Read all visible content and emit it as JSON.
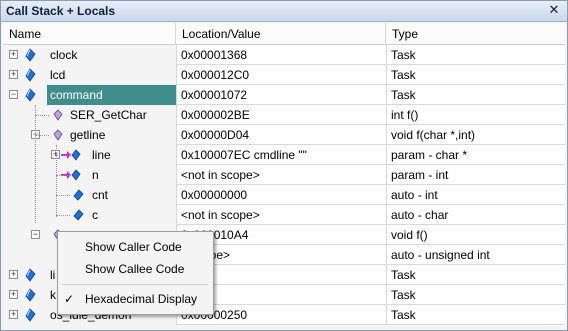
{
  "window": {
    "title": "Call Stack + Locals",
    "close_glyph": "✕"
  },
  "columns": [
    "Name",
    "Location/Value",
    "Type"
  ],
  "rows": [
    {
      "name": "clock",
      "value": "0x00001368",
      "type": "Task",
      "level": 0,
      "expander": "+",
      "icon": "task-icon"
    },
    {
      "name": "lcd",
      "value": "0x000012C0",
      "type": "Task",
      "level": 0,
      "expander": "+",
      "icon": "task-icon"
    },
    {
      "name": "command",
      "value": "0x00001072",
      "type": "Task",
      "level": 0,
      "expander": "-",
      "icon": "task-icon",
      "selected": true
    },
    {
      "name": "SER_GetChar",
      "value": "0x000002BE",
      "type": "int f()",
      "level": 1,
      "expander": "",
      "icon": "function-icon"
    },
    {
      "name": "getline",
      "value": "0x00000D04",
      "type": "void f(char *,int)",
      "level": 1,
      "expander": "-",
      "icon": "function-icon"
    },
    {
      "name": "line",
      "value": "0x100007EC cmdline \"\"",
      "type": "param - char *",
      "level": 2,
      "expander": "+",
      "icon": "param-icon"
    },
    {
      "name": "n",
      "value": "<not in scope>",
      "type": "param - int",
      "level": 2,
      "expander": "",
      "icon": "param-icon"
    },
    {
      "name": "cnt",
      "value": "0x00000000",
      "type": "auto - int",
      "level": 2,
      "expander": "",
      "icon": "variable-icon"
    },
    {
      "name": "c",
      "value": "<not in scope>",
      "type": "auto - char",
      "level": 2,
      "expander": "",
      "icon": "variable-icon"
    },
    {
      "name": "",
      "value": "0x000010A4",
      "type": "void f()",
      "level": 1,
      "expander": "-",
      "icon": "function-icon"
    },
    {
      "name": "",
      "value": "n scope>",
      "type": "auto - unsigned int",
      "level": 2,
      "expander": "",
      "icon": "variable-icon"
    },
    {
      "name": "li",
      "value": "0F1E",
      "type": "Task",
      "level": 0,
      "expander": "+",
      "icon": "task-icon"
    },
    {
      "name": "k",
      "value": "0E3E",
      "type": "Task",
      "level": 0,
      "expander": "+",
      "icon": "task-icon"
    },
    {
      "name": "os_idle_demon",
      "value": "0x00000250",
      "type": "Task",
      "level": 0,
      "expander": "+",
      "icon": "task-icon"
    }
  ],
  "context_menu": {
    "items": [
      {
        "label": "Show Caller Code",
        "checked": false
      },
      {
        "label": "Show Callee Code",
        "checked": false
      },
      {
        "label": "Hexadecimal Display",
        "checked": true
      }
    ],
    "check_glyph": "✓"
  },
  "colors": {
    "selection": "#3f8e8c",
    "task_icon": "#1f6fd6",
    "param_arrow": "#d01fd0"
  }
}
